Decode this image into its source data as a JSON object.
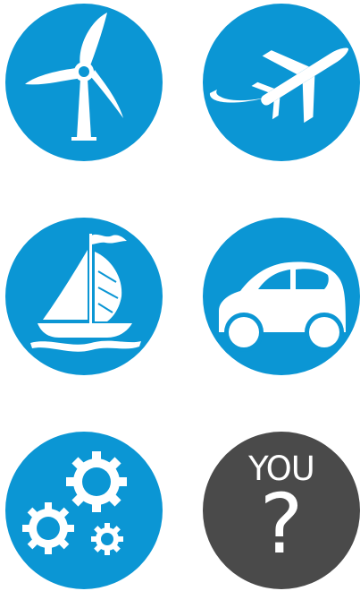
{
  "colors": {
    "accent": "#0b96d4",
    "dark": "#4a4a4a",
    "icon": "#ffffff"
  },
  "icons": [
    {
      "name": "wind-turbine-icon"
    },
    {
      "name": "airplane-icon"
    },
    {
      "name": "sailboat-icon"
    },
    {
      "name": "car-icon"
    },
    {
      "name": "gears-icon"
    },
    {
      "name": "question-icon"
    }
  ],
  "you_tile": {
    "label": "YOU",
    "mark": "?"
  }
}
